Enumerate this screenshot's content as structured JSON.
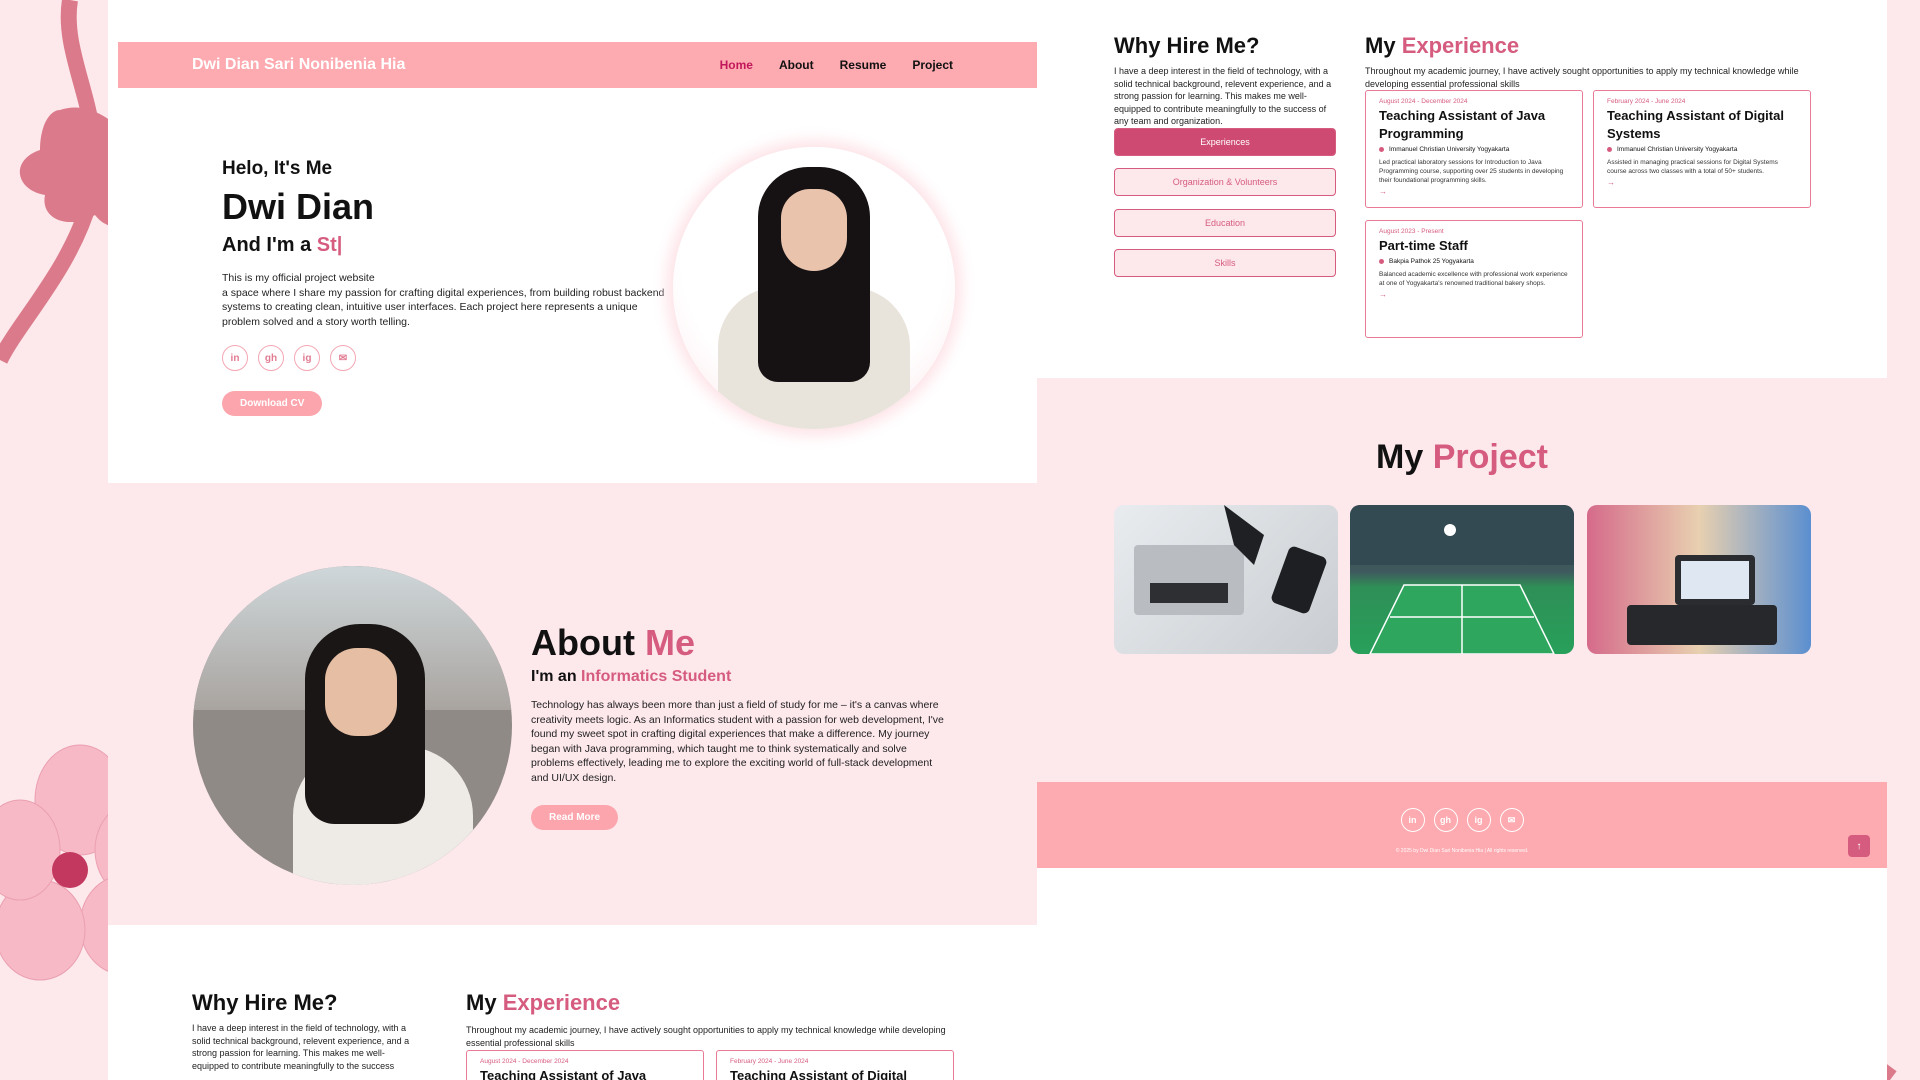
{
  "nav": {
    "brand": "Dwi Dian Sari Nonibenia Hia",
    "links": [
      "Home",
      "About",
      "Resume",
      "Project"
    ]
  },
  "hero": {
    "hello": "Helo, It's Me",
    "name": "Dwi Dian",
    "role_prefix": "And I'm a",
    "role_typed": "St|",
    "intro_1": "This is my official project website",
    "intro_2": "a space where I share my passion for crafting digital experiences, from building robust backend systems to creating clean, intuitive user interfaces. Each project here represents a unique problem solved and a story worth telling.",
    "socials": [
      "in",
      "gh",
      "ig",
      "✉"
    ],
    "download_label": "Download CV"
  },
  "about": {
    "title_main": "About",
    "title_accent": "Me",
    "sub_prefix": "I'm an",
    "sub_accent": "Informatics Student",
    "paragraph": "Technology has always been more than just a field of study for me – it's a canvas where creativity meets logic. As an Informatics student with a passion for web development, I've found my sweet spot in crafting digital experiences that make a difference. My journey began with Java programming, which taught me to think systematically and solve problems effectively, leading me to explore the exciting world of full-stack development and UI/UX design.",
    "read_more": "Read More"
  },
  "why": {
    "title": "Why Hire Me?",
    "text": "I have a deep interest in the field of technology, with a solid technical background, relevent experience, and a strong passion for learning. This makes me well-equipped to contribute meaningfully to the success of any team and organization.",
    "text_bottom": "I have a deep interest in the field of technology, with a solid technical background, relevent experience, and a strong passion for learning. This makes me well-equipped to contribute meaningfully to the success",
    "tabs": [
      "Experiences",
      "Organization & Volunteers",
      "Education",
      "Skills"
    ]
  },
  "experience": {
    "title_main": "My",
    "title_accent": "Experience",
    "intro": "Throughout my academic journey, I have actively sought opportunities to apply my technical knowledge while developing essential professional skills",
    "cards": [
      {
        "date": "August 2024 - December 2024",
        "role": "Teaching Assistant of Java Programming",
        "org": "Immanuel Christian University Yogyakarta",
        "desc": "Led practical laboratory sessions for Introduction to Java Programming course, supporting over 25 students in developing their foundational programming skills."
      },
      {
        "date": "February 2024 - June 2024",
        "role": "Teaching Assistant of Digital Systems",
        "org": "Immanuel Christian University Yogyakarta",
        "desc": "Assisted in managing practical sessions for Digital Systems course across two classes with a total of 50+ students."
      },
      {
        "date": "August 2023 - Present",
        "role": "Part-time Staff",
        "org": "Bakpia Pathok 25 Yogyakarta",
        "desc": "Balanced academic excellence with professional work experience at one of Yogyakarta's renowned traditional bakery shops."
      }
    ],
    "bottom_card_roles": [
      "Teaching Assistant of Java",
      "Teaching Assistant of Digital"
    ]
  },
  "project": {
    "title_main": "My",
    "title_accent": "Project"
  },
  "footer": {
    "socials": [
      "in",
      "gh",
      "ig",
      "✉"
    ],
    "copyright": "© 2025 by Dwi Dian Sari Nonibenia Hia | All rights reserved.",
    "to_top": "↑"
  },
  "colors": {
    "accent": "#d65c7f",
    "nav_bg": "#fdaab0",
    "section_bg": "#fde8ec"
  }
}
